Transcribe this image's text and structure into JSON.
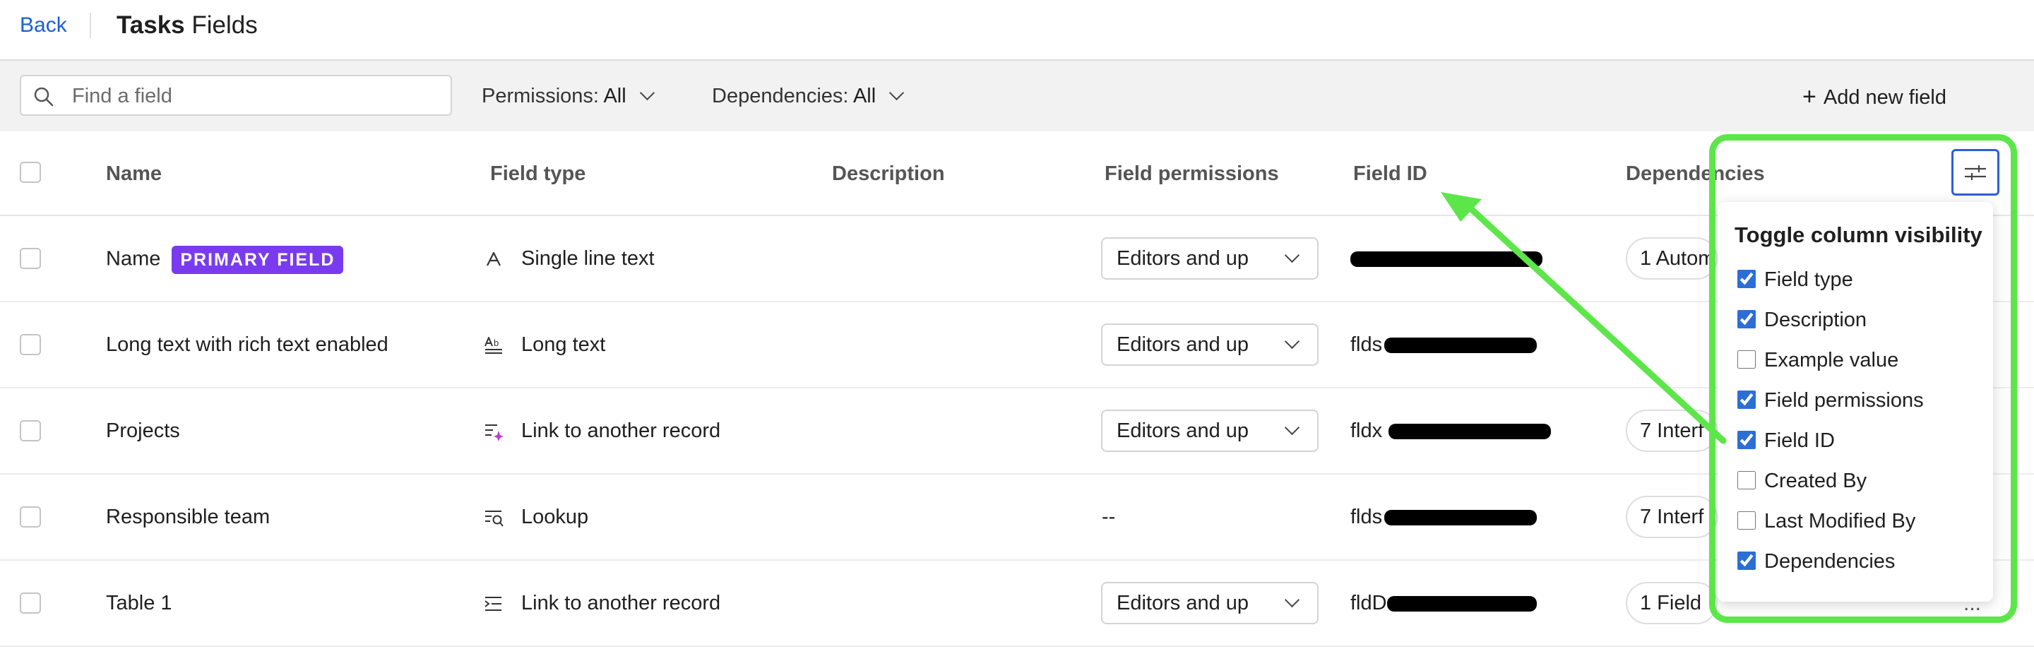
{
  "header": {
    "back_label": "Back",
    "title_bold": "Tasks",
    "title_rest": "Fields"
  },
  "toolbar": {
    "search_placeholder": "Find a field",
    "permissions_label": "Permissions:",
    "permissions_value": "All",
    "dependencies_label": "Dependencies:",
    "dependencies_value": "All",
    "add_field_label": "Add new field"
  },
  "table": {
    "columns": [
      "Name",
      "Field type",
      "Description",
      "Field permissions",
      "Field ID",
      "Dependencies"
    ],
    "primary_badge": "PRIMARY FIELD",
    "rows": [
      {
        "name": "Name",
        "type": "Single line text",
        "type_icon": "single-line-text-icon",
        "permissions": "Editors and up",
        "id_prefix": "",
        "dependency": "1 Autom"
      },
      {
        "name": "Long text with rich text enabled",
        "type": "Long text",
        "type_icon": "long-text-icon",
        "permissions": "Editors and up",
        "id_prefix": "flds",
        "dependency": ""
      },
      {
        "name": "Projects",
        "type": "Link to another record",
        "type_icon": "link-record-ai-icon",
        "permissions": "Editors and up",
        "id_prefix": "fldx",
        "dependency": "7 Interf"
      },
      {
        "name": "Responsible team",
        "type": "Lookup",
        "type_icon": "lookup-icon",
        "permissions": "--",
        "id_prefix": "flds",
        "dependency": "7 Interf"
      },
      {
        "name": "Table 1",
        "type": "Link to another record",
        "type_icon": "link-record-icon",
        "permissions": "Editors and up",
        "id_prefix": "fldD",
        "dependency": "1 Field"
      }
    ]
  },
  "column_menu": {
    "title": "Toggle column visibility",
    "options": [
      {
        "label": "Field type",
        "checked": true
      },
      {
        "label": "Description",
        "checked": true
      },
      {
        "label": "Example value",
        "checked": false
      },
      {
        "label": "Field permissions",
        "checked": true
      },
      {
        "label": "Field ID",
        "checked": true
      },
      {
        "label": "Created By",
        "checked": false
      },
      {
        "label": "Last Modified By",
        "checked": false
      },
      {
        "label": "Dependencies",
        "checked": true
      }
    ]
  },
  "colors": {
    "accent": "#1a5fd6",
    "badge": "#7a3bf0",
    "annotation": "#5de64a"
  },
  "more_label": "..."
}
